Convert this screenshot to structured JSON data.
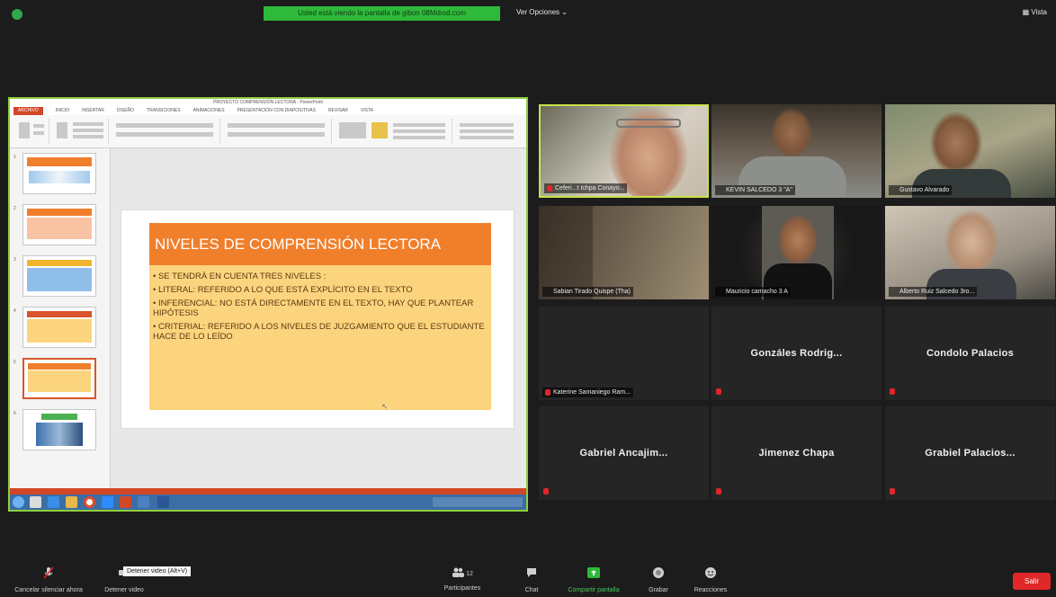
{
  "top": {
    "banner": "Usted está viendo la pantalla de gibon 08Mdrod.com",
    "view_options": "Ver Opciones ⌄",
    "view": "▦ Vista"
  },
  "powerpoint": {
    "title": "PROYECTO COMPRENSIÓN LECTORA - PowerPoint",
    "tabs": [
      "ARCHIVO",
      "INICIO",
      "INSERTAR",
      "DISEÑO",
      "TRANSICIONES",
      "ANIMACIONES",
      "PRESENTACIÓN CON DIAPOSITIVAS",
      "REVISAR",
      "VISTA"
    ],
    "slide_numbers": [
      "1",
      "2",
      "3",
      "4",
      "5",
      "6"
    ],
    "slide": {
      "heading": "NIVELES DE COMPRENSIÓN LECTORA",
      "bullets": [
        "• SE TENDRÁ EN CUENTA TRES NIVELES :",
        "• LITERAL: REFERIDO A LO QUE ESTÁ EXPLÍCITO EN EL TEXTO",
        "• INFERENCIAL: NO ESTÁ DIRECTAMENTE EN EL TEXTO, HAY QUE PLANTEAR HIPÓTESIS",
        "• CRITERIAL: REFERIDO A LOS NIVELES DE JUZGAMIENTO QUE EL ESTUDIANTE HACE DE LO LEÍDO"
      ]
    }
  },
  "participants": [
    {
      "name": "Ceferi...t Ichpa Conayo..."
    },
    {
      "name": "KEVIN SALCEDO 3 \"A\""
    },
    {
      "name": "Gustavo Alvarado"
    },
    {
      "name": "Sabian Tirado Quispe (Tha)"
    },
    {
      "name": "Mauricio camacho 3 A"
    },
    {
      "name": "Alberto Ruiz Salcedo 3ro..."
    },
    {
      "name": "Katerine Samaniego Ram..."
    },
    {
      "label": "Gonzáles Rodrig..."
    },
    {
      "label": "Condolo Palacios"
    },
    {
      "label": "Gabriel Ancajim..."
    },
    {
      "label": "Jimenez Chapa"
    },
    {
      "label": "Grabiel Palacios..."
    }
  ],
  "toolbar": {
    "mute": "Cancelar silenciar ahora",
    "video": "Detener video",
    "tooltip": "Detener video (Alt+V)",
    "participants": "Participantes",
    "participants_count": "12",
    "chat": "Chat",
    "share": "Compartir pantalla",
    "record": "Grabar",
    "reactions": "Reacciones",
    "leave": "Salir"
  },
  "colors": {
    "share_green": "#2fb93a",
    "slide_orange": "#f07f2c",
    "slide_yellow": "#fcd47d",
    "leave_red": "#e02828"
  }
}
